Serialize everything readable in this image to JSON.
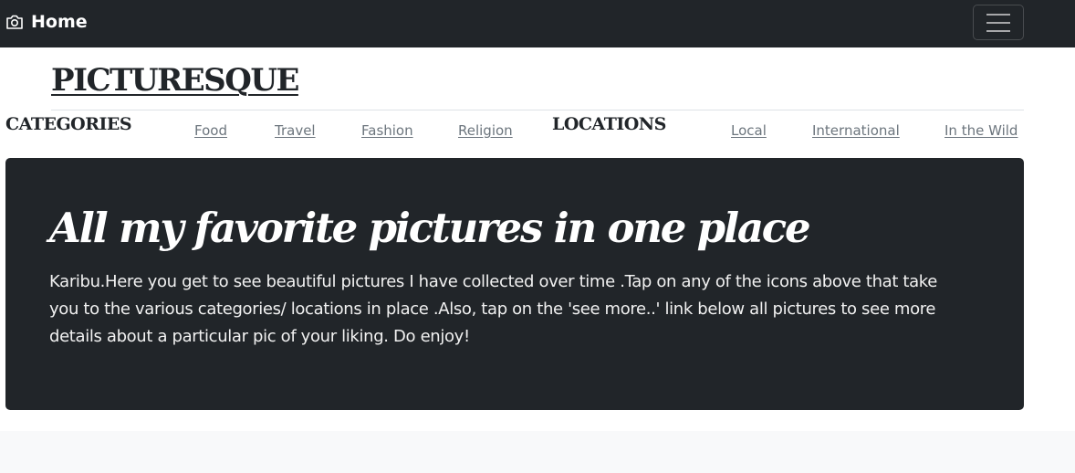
{
  "navbar": {
    "brand_label": "Home",
    "brand_icon": "camera-icon",
    "toggler_icon": "hamburger-menu-icon"
  },
  "site": {
    "title": "PICTURESQUE"
  },
  "categories": {
    "heading": "CATEGORIES",
    "links": [
      "Food",
      "Travel",
      "Fashion",
      "Religion"
    ]
  },
  "locations": {
    "heading": "LOCATIONS",
    "links": [
      "Local",
      "International",
      "In the Wild"
    ]
  },
  "jumbotron": {
    "title": "All my favorite pictures in one place",
    "text": "Karibu.Here you get to see beautiful pictures I have collected over time .Tap on any of the icons above that take you to the various categories/ locations in place .Also, tap on the 'see more..' link below all pictures to see more details about a particular pic of your liking. Do enjoy!"
  },
  "colors": {
    "navbar_bg": "#212529",
    "jumbotron_bg": "#212529",
    "link": "#6c757d",
    "text_dark": "#212529",
    "footer_bg": "#f8f9fa"
  }
}
